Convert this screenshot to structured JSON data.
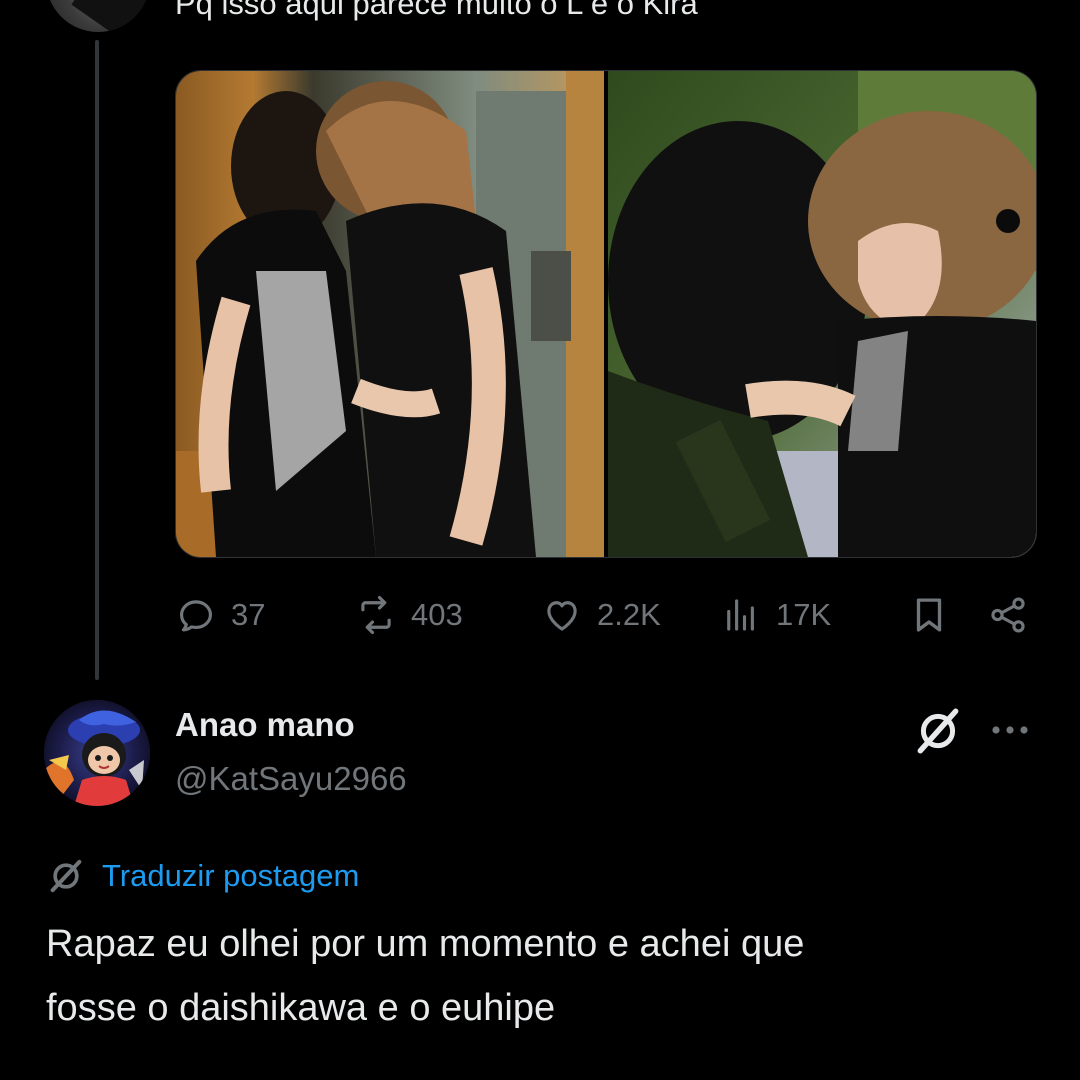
{
  "parent_tweet": {
    "text": "Pq isso aqui parece muito o L e o Kira",
    "media": [
      {
        "icon": "photo-two-people-left"
      },
      {
        "icon": "photo-two-people-right"
      }
    ],
    "actions": {
      "replies": "37",
      "reposts": "403",
      "likes": "2.2K",
      "views": "17K"
    }
  },
  "reply_tweet": {
    "display_name": "Anao mano",
    "handle": "@KatSayu2966",
    "translate_label": "Traduzir postagem",
    "text_lines": [
      "Rapaz eu olhei por um momento e achei que",
      "fosse o daishikawa e o euhipe"
    ]
  },
  "colors": {
    "background": "#000000",
    "text_primary": "#e7e9ea",
    "text_secondary": "#71767b",
    "link": "#1d9bf0",
    "divider": "#333639"
  }
}
